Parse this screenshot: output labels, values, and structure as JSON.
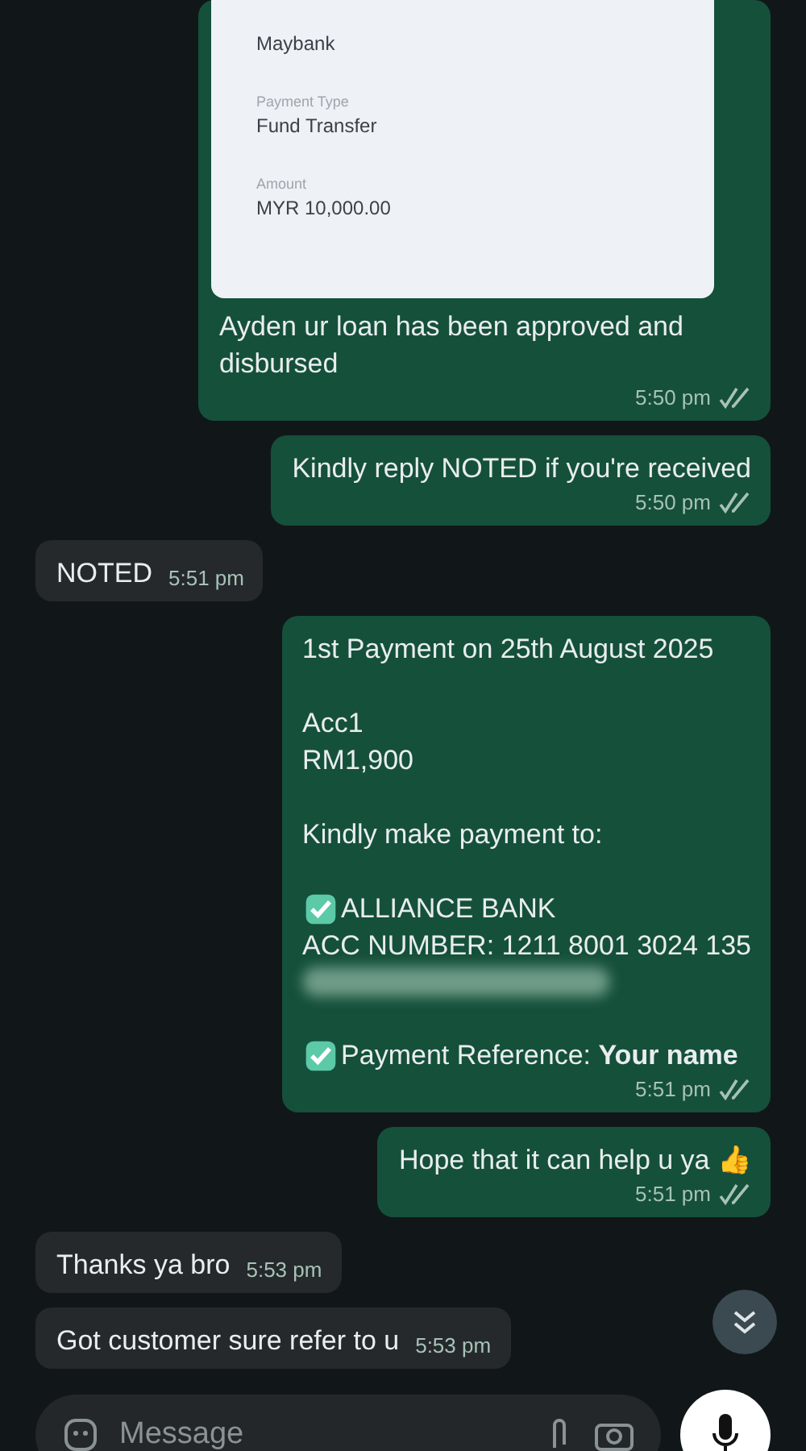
{
  "messages": [
    {
      "kind": "receipt",
      "outgoing": true,
      "receipt_fields": [
        {
          "value": "Maybank"
        },
        {
          "label": "Payment Type",
          "value": "Fund Transfer"
        },
        {
          "label": "Amount",
          "value": "MYR 10,000.00"
        }
      ],
      "lines": [
        {
          "text": "Ayden ur loan has been approved and disbursed"
        }
      ],
      "time": "5:50 pm",
      "read": true
    },
    {
      "kind": "text",
      "outgoing": true,
      "lines": [
        {
          "text": "Kindly reply NOTED if you're received"
        }
      ],
      "time": "5:50 pm",
      "read": true
    },
    {
      "kind": "text",
      "outgoing": false,
      "lines": [
        {
          "text": "NOTED"
        }
      ],
      "time": "5:51 pm"
    },
    {
      "kind": "text",
      "outgoing": true,
      "lines": [
        {
          "text": "1st Payment on 25th August 2025"
        },
        {
          "kind": "blank"
        },
        {
          "text": "Acc1"
        },
        {
          "text": "RM1,900"
        },
        {
          "kind": "blank"
        },
        {
          "text": "Kindly make payment to:"
        },
        {
          "kind": "blank"
        },
        {
          "text": "ALLIANCE BANK",
          "checkmark": true
        },
        {
          "text": "ACC NUMBER: 1211 8001 3024 135"
        },
        {
          "kind": "redacted"
        },
        {
          "kind": "blank"
        },
        {
          "text": "Payment Reference: **Your name**",
          "checkmark": true
        }
      ],
      "time": "5:51 pm",
      "read": true
    },
    {
      "kind": "text",
      "outgoing": true,
      "lines": [
        {
          "text": "Hope that it can help u ya 👍"
        }
      ],
      "time": "5:51 pm",
      "read": true
    },
    {
      "kind": "text",
      "outgoing": false,
      "lines": [
        {
          "text": "Thanks ya bro"
        }
      ],
      "time": "5:53 pm"
    },
    {
      "kind": "text",
      "outgoing": false,
      "lines": [
        {
          "text": "Got customer sure refer to u"
        }
      ],
      "time": "5:53 pm"
    }
  ],
  "composer": {
    "placeholder": "Message"
  }
}
